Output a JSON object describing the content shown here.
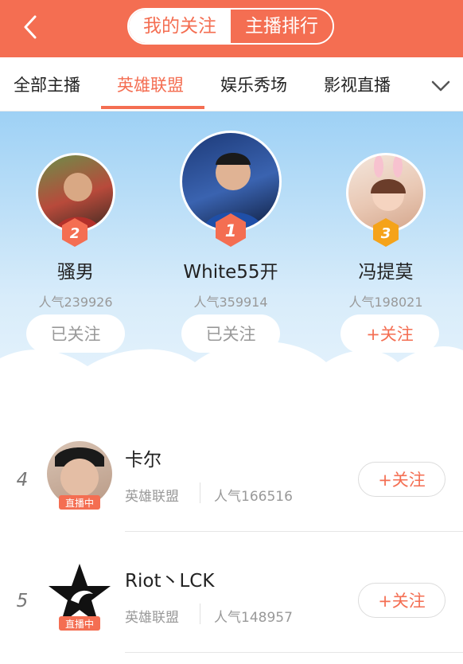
{
  "header": {
    "segments": [
      {
        "label": "我的关注",
        "active": false
      },
      {
        "label": "主播排行",
        "active": true
      }
    ]
  },
  "tabs": [
    {
      "label": "全部主播",
      "active": false
    },
    {
      "label": "英雄联盟",
      "active": true
    },
    {
      "label": "娱乐秀场",
      "active": false
    },
    {
      "label": "影视直播",
      "active": false
    }
  ],
  "podium": [
    {
      "rank": "2",
      "name": "骚男",
      "popularity": "人气239926",
      "button": "已关注",
      "followed": true
    },
    {
      "rank": "1",
      "name": "White55开",
      "popularity": "人气359914",
      "button": "已关注",
      "followed": true
    },
    {
      "rank": "3",
      "name": "冯提莫",
      "popularity": "人气198021",
      "button": "+关注",
      "followed": false
    }
  ],
  "list": [
    {
      "rank": "4",
      "name": "卡尔",
      "category": "英雄联盟",
      "popularity": "人气166516",
      "live_badge": "直播中",
      "button": "+关注"
    },
    {
      "rank": "5",
      "name": "Riot丶LCK",
      "category": "英雄联盟",
      "popularity": "人气148957",
      "live_badge": "直播中",
      "button": "+关注"
    }
  ],
  "colors": {
    "accent": "#f46e52",
    "sky": "#9ed1f5",
    "gold": "#f5a31a"
  }
}
